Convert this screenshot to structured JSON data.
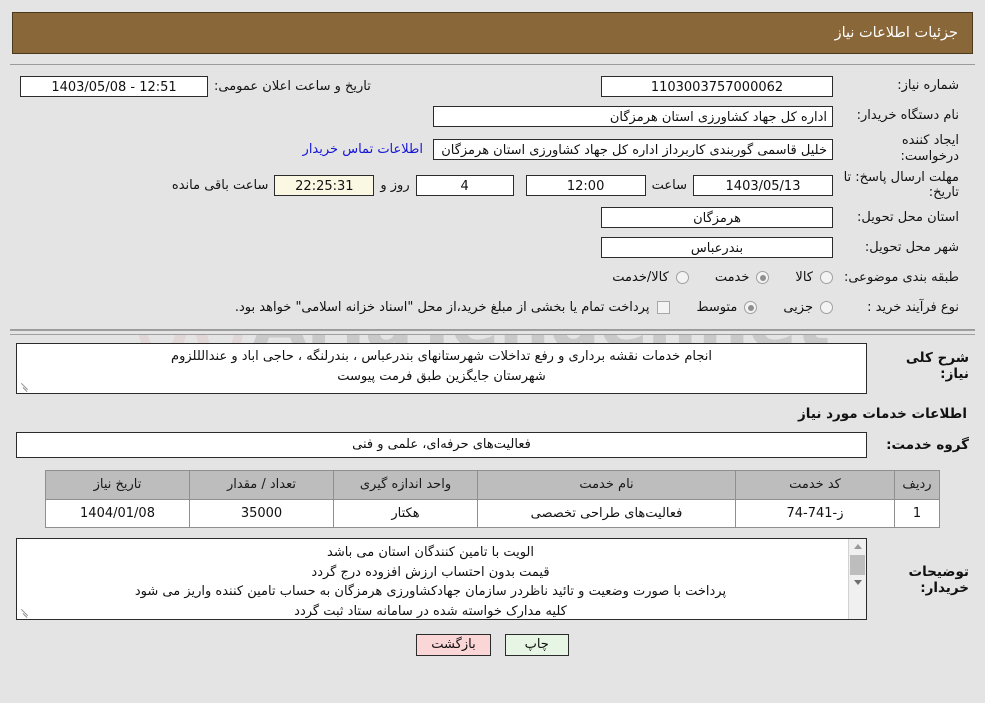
{
  "header": {
    "title": "جزئیات اطلاعات نیاز"
  },
  "watermark": {
    "text": "AriaTender.net"
  },
  "form": {
    "need_number": {
      "label": "شماره نیاز:",
      "value": "1103003757000062"
    },
    "buyer_org": {
      "label": "نام دستگاه خریدار:",
      "value": "اداره کل جهاد کشاورزی استان هرمزگان"
    },
    "request_creator": {
      "label": "ایجاد کننده درخواست:",
      "value": "خلیل قاسمی گوربندی کاربرداز اداره کل جهاد کشاورزی استان هرمزگان"
    },
    "contact_link": "اطلاعات تماس خریدار",
    "public_announce": {
      "label": "تاریخ و ساعت اعلان عمومی:",
      "value": "12:51 - 1403/05/08"
    },
    "deadline": {
      "label": "مهلت ارسال پاسخ: تا تاریخ:",
      "date": "1403/05/13",
      "time_label": "ساعت",
      "time": "12:00",
      "days": "4",
      "days_suffix": "روز و",
      "clock": "22:25:31",
      "remaining_suffix": "ساعت باقی مانده"
    },
    "province": {
      "label": "استان محل تحویل:",
      "value": "هرمزگان"
    },
    "city": {
      "label": "شهر محل تحویل:",
      "value": "بندرعباس"
    },
    "classification": {
      "label": "طبقه بندی موضوعی:",
      "options": [
        {
          "label": "کالا",
          "selected": false
        },
        {
          "label": "خدمت",
          "selected": true
        },
        {
          "label": "کالا/خدمت",
          "selected": false
        }
      ]
    },
    "process_type": {
      "label": "نوع فرآیند خرید :",
      "options": [
        {
          "label": "جزیی",
          "selected": false
        },
        {
          "label": "متوسط",
          "selected": true
        }
      ],
      "checkbox_note": "پرداخت تمام یا بخشی از مبلغ خرید،از محل \"اسناد خزانه اسلامی\" خواهد بود.",
      "checkbox_checked": false
    },
    "description": {
      "label": "شرح کلی نیاز:",
      "line1": "انجام خدمات نقشه برداری و رفع تداخلات شهرستانهای بندرعباس ، بندرلنگه ، حاجی اباد و عندالللزوم",
      "line2": "شهرستان جایگزین طبق فرمت پیوست"
    }
  },
  "services_section": {
    "heading": "اطلاعات خدمات مورد نیاز",
    "service_group": {
      "label": "گروه خدمت:",
      "value": "فعالیت‌های حرفه‌ای، علمی و فنی"
    },
    "table": {
      "columns": [
        "ردیف",
        "کد خدمت",
        "نام خدمت",
        "واحد اندازه گیری",
        "تعداد / مقدار",
        "تاریخ نیاز"
      ],
      "rows": [
        {
          "radif": "1",
          "code": "ز-741-74",
          "name": "فعالیت‌های طراحی تخصصی",
          "unit": "هکتار",
          "quantity": "35000",
          "need_date": "1404/01/08"
        }
      ]
    }
  },
  "buyer_notes": {
    "label": "توضیحات خریدار:",
    "line1": "الویت با تامین کنندگان استان می باشد",
    "line2": "قیمت بدون احتساب ارزش افزوده درج گردد",
    "line3": "پرداخت  با صورت وضعیت و تائید ناظردر سازمان جهادکشاورزی هرمزگان  به حساب تامین کننده واریز می شود",
    "line4": "کلیه مدارک خواسته شده در سامانه ستاد ثبت گردد"
  },
  "footer": {
    "print_label": "چاپ",
    "back_label": "بازگشت"
  },
  "colors": {
    "header_bg": "#8a6738",
    "page_bg": "#e4e4e4",
    "link": "#1515d8",
    "print_btn": "#e7f6e4",
    "back_btn": "#fbd6d6",
    "beige_field": "#faf7e3"
  }
}
